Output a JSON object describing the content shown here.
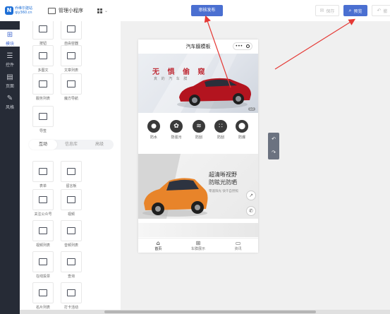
{
  "topbar": {
    "logo_line1": "乔维尔建站",
    "logo_line2": "qiy360.cn",
    "manage_label": "管理小程序",
    "publish_label": "审核发布",
    "save_label": "保存",
    "preview_label": "预览",
    "undo_label": "撤"
  },
  "rail": {
    "items": [
      {
        "label": "模块",
        "icon": "plus-square-icon"
      },
      {
        "label": "控件",
        "icon": "sliders-icon"
      },
      {
        "label": "页面",
        "icon": "pages-icon"
      },
      {
        "label": "风格",
        "icon": "brush-icon"
      }
    ]
  },
  "panel": {
    "components_top": [
      {
        "label": "按钮"
      },
      {
        "label": "自由容器"
      },
      {
        "label": "多图文"
      },
      {
        "label": "文章列表"
      },
      {
        "label": "服务列表"
      },
      {
        "label": "魔方导航"
      },
      {
        "label": "导签"
      }
    ],
    "tabs": [
      {
        "label": "互动"
      },
      {
        "label": "信息库"
      },
      {
        "label": "高级"
      }
    ],
    "components_interact": [
      {
        "label": "表单"
      },
      {
        "label": "留言板"
      },
      {
        "label": "关注公众号"
      },
      {
        "label": "视频"
      },
      {
        "label": "视频列表"
      },
      {
        "label": "音频列表"
      },
      {
        "label": "在线投票"
      },
      {
        "label": "查询"
      },
      {
        "label": "名片列表"
      },
      {
        "label": "打卡活动"
      }
    ]
  },
  "phone": {
    "title": "汽车膜模板",
    "capsule_more": "•••",
    "banner1": {
      "headline": "无 惧 偷 窥",
      "subline": "真 的 汽 车 膜",
      "pager": "1/2"
    },
    "feature_icons": [
      {
        "label": "防水"
      },
      {
        "label": "防强污"
      },
      {
        "label": "防刮"
      },
      {
        "label": "防刮"
      },
      {
        "label": "防爆"
      }
    ],
    "banner2": {
      "headline_1": "超清晰视野",
      "headline_2": "防眩光防晒",
      "subline": "零遥阳光 快干自然照"
    },
    "tabbar": [
      {
        "label": "首页"
      },
      {
        "label": "车膜展示"
      },
      {
        "label": "资讯"
      }
    ]
  },
  "colors": {
    "accent": "#4a6fd1",
    "rail_bg": "#262b36",
    "arrow": "#e53935"
  }
}
